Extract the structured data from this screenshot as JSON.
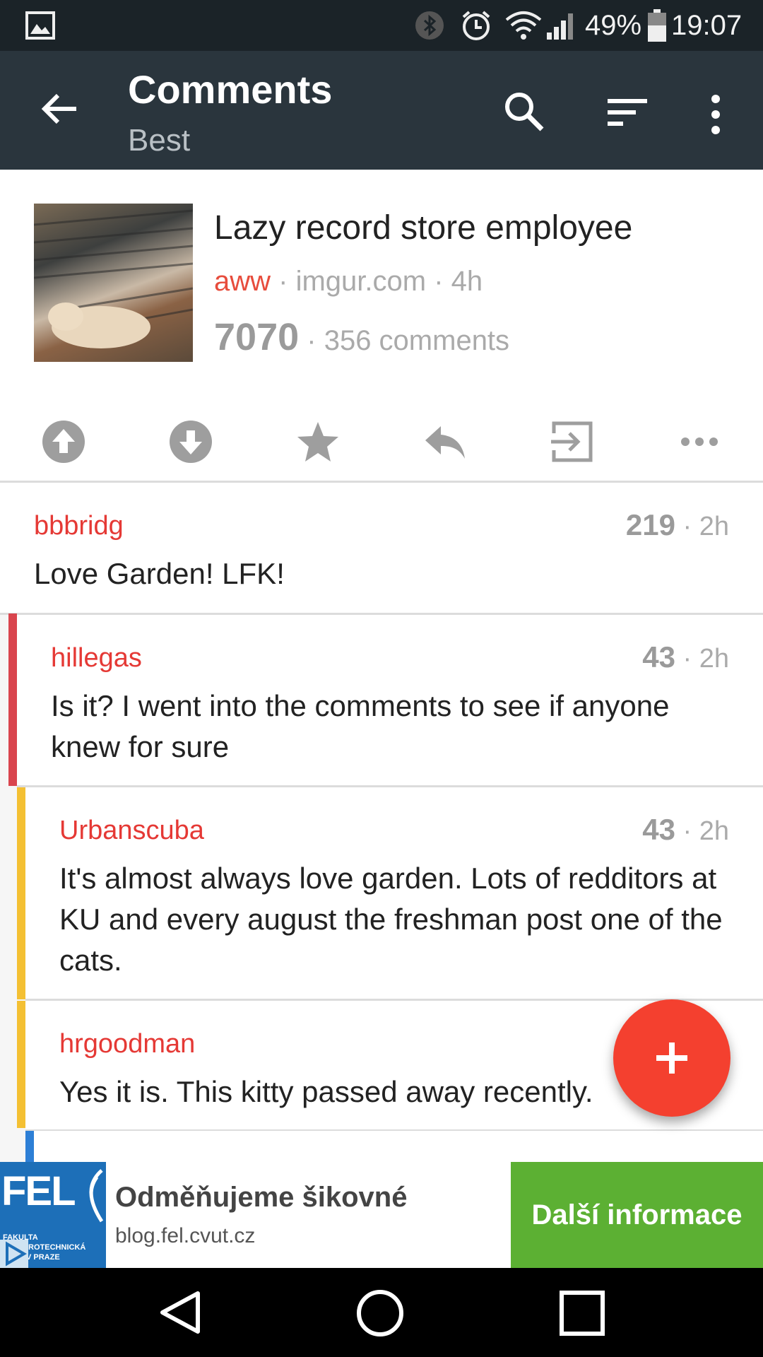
{
  "status_bar": {
    "battery": "49%",
    "time": "19:07"
  },
  "app_bar": {
    "title": "Comments",
    "subtitle": "Best"
  },
  "post": {
    "title": "Lazy record store employee",
    "subreddit": "aww",
    "domain": "imgur.com",
    "age": "4h",
    "score": "7070",
    "comments": "356 comments"
  },
  "comments": [
    {
      "author": "bbbridg",
      "points": "219",
      "age": "2h",
      "body": "Love Garden! LFK!"
    },
    {
      "author": "hillegas",
      "points": "43",
      "age": "2h",
      "body": "Is it? I went into the comments to see if anyone knew for sure",
      "bar_color": "#d9454e"
    },
    {
      "author": "Urbanscuba",
      "points": "43",
      "age": "2h",
      "body": "It's almost always love garden. Lots of redditors at KU and every august the freshman post one of the cats.",
      "bar_color": "#f4c033"
    },
    {
      "author": "hrgoodman",
      "body": "Yes it is. This kitty passed away recently.",
      "bar_color": "#f4c033"
    }
  ],
  "next_bar_color": "#2d7fd6",
  "accent_color": "#e53935",
  "fab_color": "#f4402f",
  "ad": {
    "logo_text": "FEL",
    "logo_subtext": "FAKULTA ELEKTROTECHNICKÁ ČVUT V PRAZE",
    "title": "Odměňujeme šikovné",
    "url": "blog.fel.cvut.cz",
    "button": "Další informace"
  }
}
